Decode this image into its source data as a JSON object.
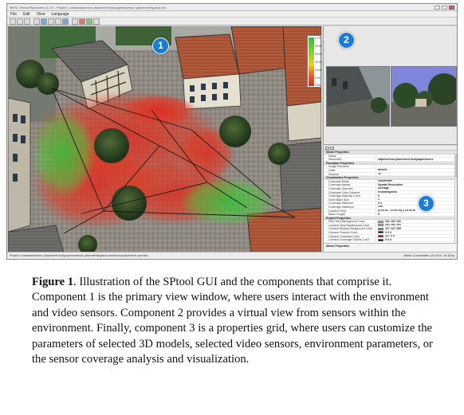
{
  "window": {
    "title": "MERL SensorPlacement v1.2.0 - Project: c:\\instead\\sensor placement tool\\papers\\sensor placement\\sptool.xml"
  },
  "menu": [
    "File",
    "Edit",
    "View",
    "Language"
  ],
  "badges": [
    "1",
    "2",
    "3"
  ],
  "legend": {
    "labels": [
      "0.73",
      "25.00",
      "20.00",
      "15.00",
      "10.00",
      "5.00",
      "0.00"
    ],
    "colors": [
      "#2fbf2f",
      "#f1d21c",
      "#d62b21"
    ]
  },
  "property_grid": {
    "rows": [
      {
        "section": "Model Properties"
      },
      {
        "key": "Name",
        "value": ""
      },
      {
        "key": "SensorsID",
        "value": "sltpe\\sensor placement tool\\papers\\sens"
      },
      {
        "section": "Floorplan Properties"
      },
      {
        "key": "Image Filename",
        "value": ""
      },
      {
        "key": "Units",
        "value": "Meters"
      },
      {
        "key": "Spacing",
        "value": "10"
      },
      {
        "section": "Visualization Properties"
      },
      {
        "key": "Coverage Mode",
        "value": "Volumetric"
      },
      {
        "key": "Coverage Aspect",
        "value": "Spatial Resolution"
      },
      {
        "key": "Coverage Operator",
        "value": "Average"
      },
      {
        "key": "Coverage Color Scheme",
        "value": "Redmintgreek"
      },
      {
        "key": "Coverage Maxmap Level",
        "value": "0"
      },
      {
        "key": "Voxel Base Size",
        "value": "1"
      },
      {
        "key": "Coverage Minimum",
        "value": "0.1"
      },
      {
        "key": "Coverage Maximum",
        "value": "100"
      },
      {
        "key": "Camera Field",
        "value": "(0.00 m - 10.00 m) x 20.00 m"
      },
      {
        "key": "Basic Length",
        "value": "0"
      },
      {
        "section": "Project Properties"
      },
      {
        "key": "Plan View Background Color",
        "value": "191 191 191",
        "swatch": "#bfbfbf"
      },
      {
        "key": "Camera View Background Color",
        "value": "191 191 191",
        "swatch": "#bfbfbf"
      },
      {
        "key": "Camera Display Background Color",
        "value": "127 127 255",
        "swatch": "#7f7fff"
      },
      {
        "key": "Camera Frustum Color",
        "value": "0 0 0",
        "swatch": "#000000"
      },
      {
        "key": "Camera Coverage Color",
        "value": "127 0 0",
        "swatch": "#7f0000"
      },
      {
        "key": "Camera Coverage Outline Color",
        "value": "0 0 0",
        "swatch": "#000000"
      }
    ],
    "description_title": "Model Properties"
  },
  "statusbar": {
    "left": "Project c:\\instead\\sensor placement tool\\papers\\sensor placement\\sptool.xml\\sensorplacement opened.",
    "right": "World Coordinates: (28.97m, 13.42m)"
  },
  "caption": {
    "label": "Figure 1",
    "text": ". Illustration of the SPtool GUI and the components that comprise it.  Component 1 is the primary view window, where users interact with the environment and video sensors.  Component 2 provides a virtual view from sensors within the environment.  Finally, component 3 is a properties grid, where users can customize the parameters of selected 3D models, selected video sensors, environment parameters, or the sensor coverage analysis and visualization."
  }
}
